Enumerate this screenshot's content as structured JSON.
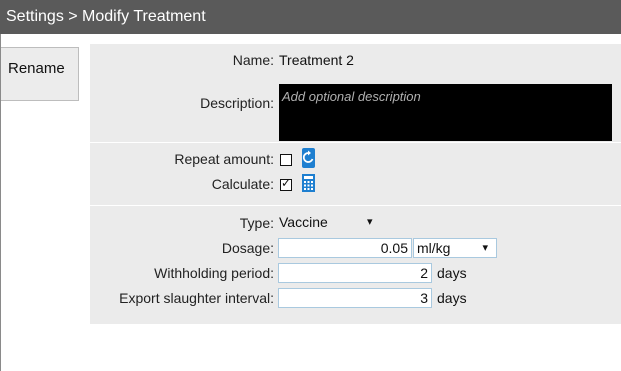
{
  "header": {
    "title": "Settings > Modify Treatment"
  },
  "sidebar": {
    "rename_label": "Rename"
  },
  "form": {
    "name_label": "Name:",
    "name_value": "Treatment 2",
    "description_label": "Description:",
    "description_placeholder": "Add optional description",
    "repeat_label": "Repeat amount:",
    "repeat_checked": false,
    "calculate_label": "Calculate:",
    "calculate_checked": true,
    "type_label": "Type:",
    "type_value": "Vaccine",
    "dosage_label": "Dosage:",
    "dosage_value": "0.05",
    "dosage_unit": "ml/kg",
    "withholding_label": "Withholding period:",
    "withholding_value": "2",
    "withholding_unit": "days",
    "export_label": "Export slaughter interval:",
    "export_value": "3",
    "export_unit": "days"
  },
  "icons": {
    "repeat": "refresh-icon",
    "calculate": "calculator-icon",
    "dropdown": "caret-down-icon"
  },
  "colors": {
    "titlebar": "#5a5a5a",
    "panel": "#ebebeb",
    "accent": "#1e7fd0",
    "description_bg": "#000000"
  }
}
